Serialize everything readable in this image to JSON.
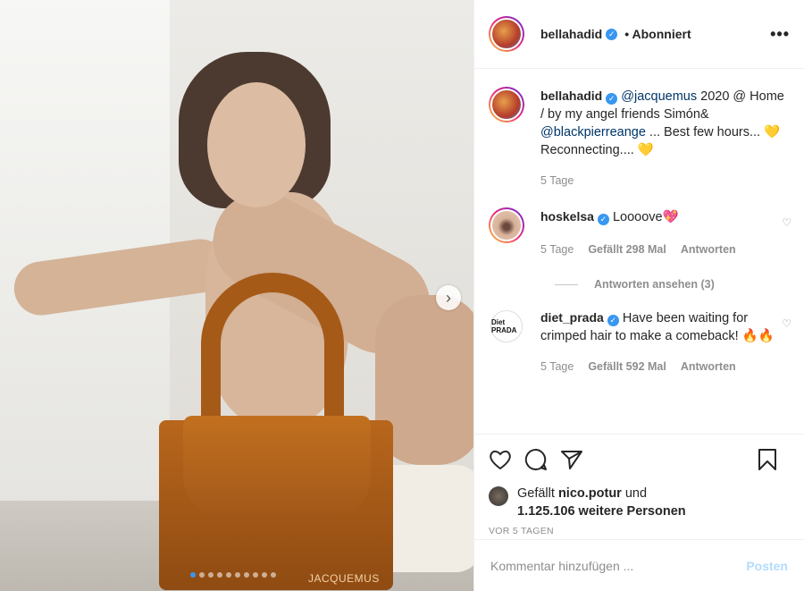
{
  "header": {
    "username": "bellahadid",
    "follow_status": "Abonniert",
    "more": "•••"
  },
  "media": {
    "brand_text": "JACQUEMUS",
    "carousel_count": 10,
    "carousel_active_index": 0
  },
  "caption": {
    "username": "bellahadid",
    "mention1": "@jacquemus",
    "text1": " 2020 @ Home / by my angel friends Simón& ",
    "mention2": "@blackpierreange",
    "text2": " ... Best few hours... 💛 Reconnecting.... 💛",
    "time": "5 Tage"
  },
  "comments": [
    {
      "username": "hoskelsa",
      "text": "Loooove💖",
      "time": "5 Tage",
      "likes": "Gefällt 298 Mal",
      "reply": "Antworten",
      "view_replies": "Antworten ansehen (3)"
    },
    {
      "username": "diet_prada",
      "avatar_text": "Diet PRADA",
      "text": "Have been waiting for crimped hair to make a comeback! 🔥🔥",
      "time": "5 Tage",
      "likes": "Gefällt 592 Mal",
      "reply": "Antworten"
    }
  ],
  "likes": {
    "prefix": "Gefällt ",
    "user": "nico.potur",
    "mid": " und",
    "count": "1.125.106 weitere Personen"
  },
  "age": "VOR 5 TAGEN",
  "add_comment": {
    "placeholder": "Kommentar hinzufügen ...",
    "post_label": "Posten"
  },
  "colors": {
    "verified": "#3897f0",
    "mention": "#003569",
    "post_disabled": "#b3dbff"
  }
}
